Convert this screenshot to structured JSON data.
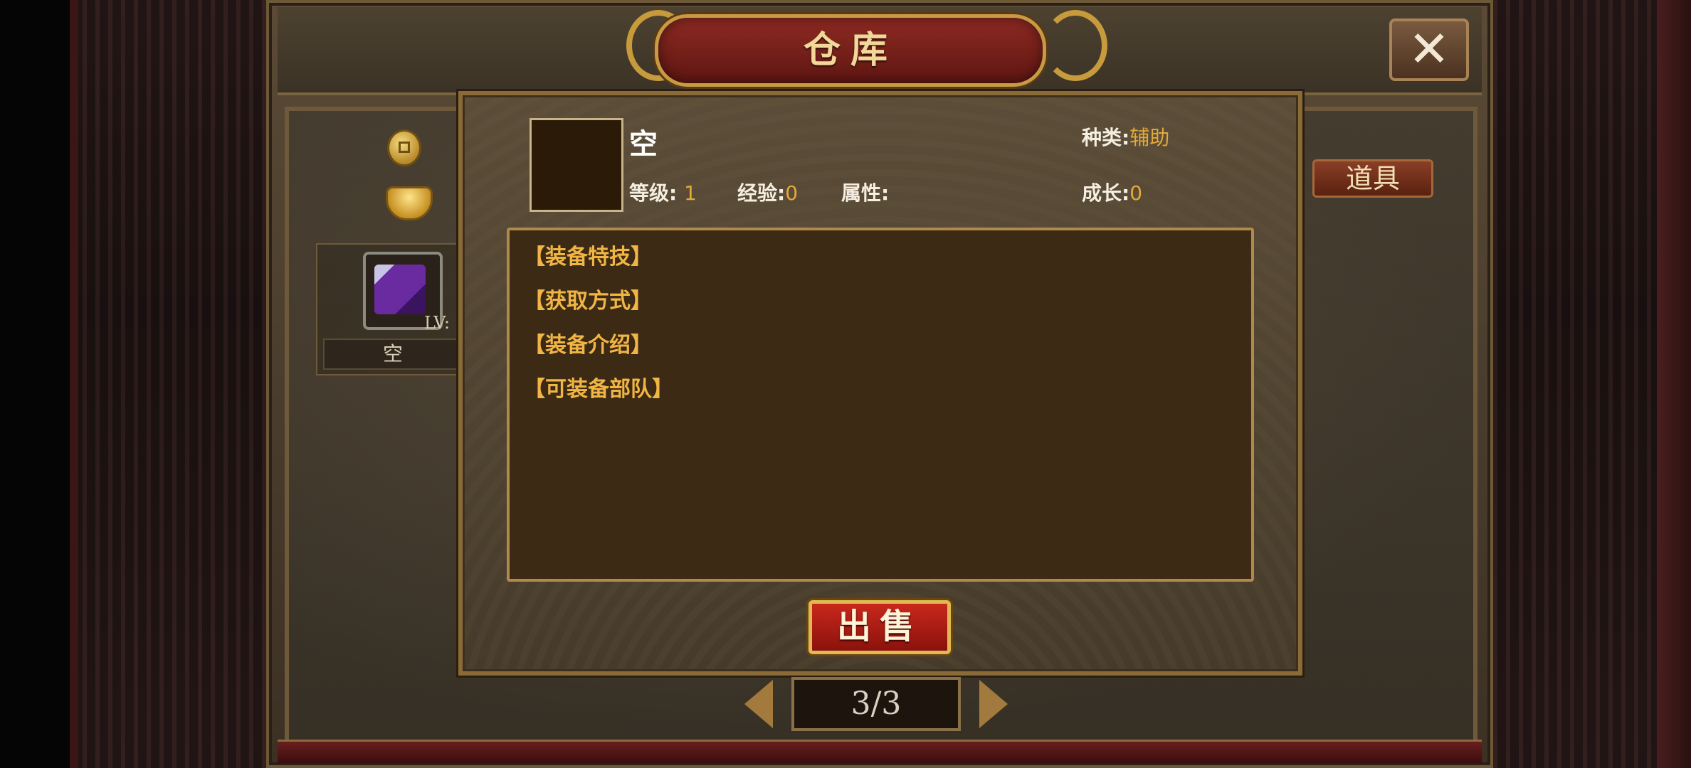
{
  "window": {
    "title": "仓库",
    "close_icon": "close-icon"
  },
  "currency": {
    "coin_icon": "copper-coin-icon",
    "ingot_icon": "gold-ingot-icon"
  },
  "item_card": {
    "level_label": "LV:",
    "name": "空"
  },
  "tabs": {
    "items_tab": "道具"
  },
  "detail": {
    "name": "空",
    "type_label": "种类:",
    "type_value": "辅助",
    "level_label": "等级:",
    "level_value": "1",
    "exp_label": "经验:",
    "exp_value": "0",
    "attr_label": "属性:",
    "attr_value": "",
    "growth_label": "成长:",
    "growth_value": "0",
    "sections": [
      "【装备特技】",
      "【获取方式】",
      "【装备介绍】",
      "【可装备部队】"
    ],
    "sell_button": "出售"
  },
  "pager": {
    "text": "3/3"
  },
  "colors": {
    "accent_gold": "#e2a93b",
    "section_orange": "#f0b545",
    "sell_red": "#c9281c"
  }
}
